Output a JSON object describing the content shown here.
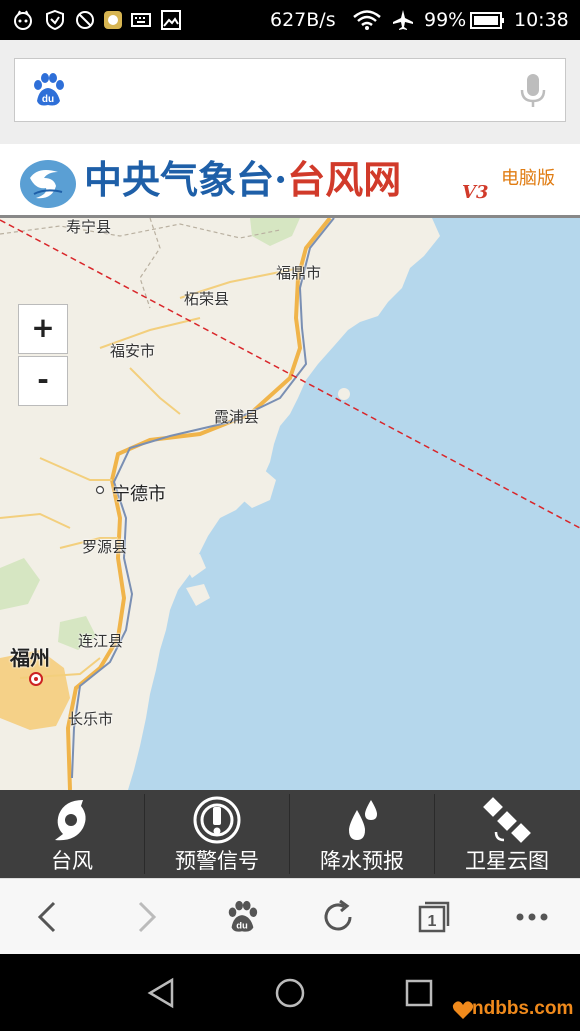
{
  "status_bar": {
    "net_speed": "627B/s",
    "battery": "99%",
    "time": "10:38",
    "icons": [
      "notification-icon",
      "shield-icon",
      "vpn-icon",
      "app-icon",
      "keyboard-icon",
      "image-icon",
      "wifi-icon",
      "airplane-icon",
      "battery-icon"
    ]
  },
  "search": {
    "placeholder": "",
    "left_icon": "baidu-paw-icon",
    "right_icon": "microphone-icon"
  },
  "site": {
    "title_main": "中央气象台·",
    "title_accent": "台风网",
    "version": "V3",
    "desktop_link": "电脑版"
  },
  "map": {
    "zoom_in": "+",
    "zoom_out": "-",
    "labels": {
      "shouning": "寿宁县",
      "fuding": "福鼎市",
      "zherong": "柘荣县",
      "fuan": "福安市",
      "xiapu": "霞浦县",
      "ningde": "宁德市",
      "luoyuan": "罗源县",
      "lianjiang": "连江县",
      "fuzhou": "福州",
      "changle": "长乐市"
    },
    "colors": {
      "sea": "#b5d7ec",
      "land": "#f2efe6",
      "route": "#d9262a"
    }
  },
  "functions": [
    {
      "label": "台风",
      "icon": "typhoon-icon"
    },
    {
      "label": "预警信号",
      "icon": "warning-signal-icon"
    },
    {
      "label": "降水预报",
      "icon": "rain-drops-icon"
    },
    {
      "label": "卫星云图",
      "icon": "satellite-icon"
    }
  ],
  "browser_nav": {
    "tab_count": "1",
    "icons": [
      "back-icon",
      "forward-icon",
      "baidu-home-icon",
      "refresh-icon",
      "tabs-icon",
      "more-icon"
    ]
  },
  "watermark": "ndbbs.com"
}
